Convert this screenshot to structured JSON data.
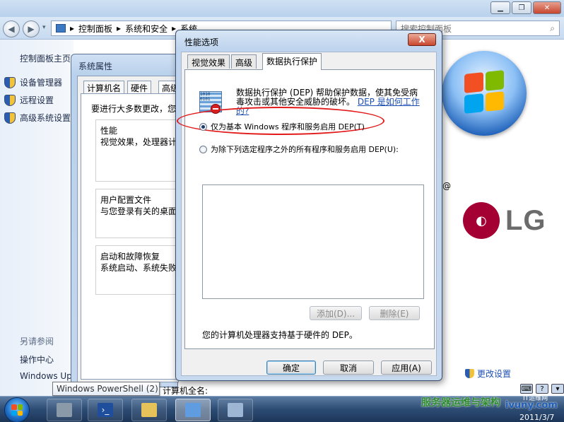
{
  "control_panel": {
    "breadcrumb": [
      "控制面板",
      "系统和安全",
      "系统"
    ],
    "search_placeholder": "搜索控制面板",
    "sidebar": {
      "home": "控制面板主页",
      "items": [
        "设备管理器",
        "远程设置",
        "高级系统设置"
      ],
      "see_also_heading": "另请参阅",
      "see_also": [
        "操作中心",
        "Windows Up"
      ]
    },
    "brand_at": "@",
    "lg_logo": "LG",
    "change_settings": "更改设置"
  },
  "system_properties": {
    "title": "系统属性",
    "tabs": [
      "计算机名",
      "硬件",
      "高级"
    ],
    "intro": "要进行大多数更改，您",
    "groups": [
      {
        "label": "性能",
        "desc": "视觉效果，处理器计"
      },
      {
        "label": "用户配置文件",
        "desc": "与您登录有关的桌面"
      },
      {
        "label": "启动和故障恢复",
        "desc": "系统启动、系统失败"
      }
    ]
  },
  "performance_options": {
    "title": "性能选项",
    "close_label": "X",
    "tabs": [
      "视觉效果",
      "高级",
      "数据执行保护"
    ],
    "dep_icon_text": "1010 0101",
    "description": "数据执行保护 (DEP) 帮助保护数据，使其免受病毒攻击或其他安全威胁的破坏。",
    "help_link": "DEP 是如何工作的?",
    "radio_windows_only": "仅为基本 Windows 程序和服务启用 DEP(T)",
    "radio_all_except": "为除下列选定程序之外的所有程序和服务启用 DEP(U):",
    "add_button": "添加(D)...",
    "remove_button": "删除(E)",
    "hardware_support": "您的计算机处理器支持基于硬件的 DEP。",
    "ok_button": "确定",
    "cancel_button": "取消",
    "apply_button": "应用(A)"
  },
  "tooltip": "Windows PowerShell (2)",
  "under_tooltip_text": "计算机全名:",
  "watermark": {
    "text": "服务器运维与架构",
    "url": "ivuny.com",
    "ribbon": "IT运维网"
  },
  "taskbar": {
    "date": "2011/3/7"
  },
  "colors": {
    "highlight_ellipse": "#e21a1a",
    "lg_red": "#a50034",
    "link_blue": "#1c4fb4"
  }
}
